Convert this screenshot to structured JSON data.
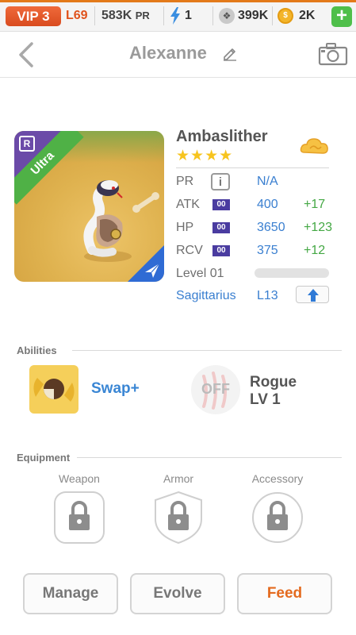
{
  "status_bar": {
    "vip": "VIP 3",
    "level": "L69",
    "pr_value": "583K",
    "pr_unit": "PR",
    "energy": "1",
    "paw": "399K",
    "coins": "2K",
    "add_symbol": "+"
  },
  "header": {
    "title": "Alexanne"
  },
  "monster": {
    "rarity_ribbon": "Ultra",
    "rank_letter": "R",
    "name": "Ambaslither",
    "stars": "★★★★",
    "stats": {
      "pr_label": "PR",
      "pr_value": "N/A",
      "atk_label": "ATK",
      "atk_value": "400",
      "atk_bonus": "+17",
      "hp_label": "HP",
      "hp_value": "3650",
      "hp_bonus": "+123",
      "rcv_label": "RCV",
      "rcv_value": "375",
      "rcv_bonus": "+12",
      "badge": "00",
      "info_symbol": "i"
    },
    "level_label": "Level 01",
    "level_progress": 0.0,
    "sign": "Sagittarius",
    "sign_level": "L13"
  },
  "abilities": {
    "heading": "Abilities",
    "active_name": "Swap+",
    "passive_state": "OFF",
    "passive_name": "Rogue",
    "passive_level": "LV 1"
  },
  "equipment": {
    "heading": "Equipment",
    "slots": [
      "Weapon",
      "Armor",
      "Accessory"
    ]
  },
  "actions": {
    "manage": "Manage",
    "evolve": "Evolve",
    "feed": "Feed"
  },
  "colors": {
    "accent_orange": "#e46a1e",
    "link_blue": "#3a7fd0",
    "bonus_green": "#44a844",
    "star_yellow": "#f7c41e"
  }
}
